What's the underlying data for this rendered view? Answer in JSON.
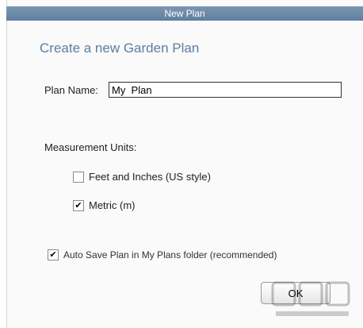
{
  "window": {
    "title": "New Plan"
  },
  "dialog": {
    "heading": "Create a new Garden Plan",
    "plan_name_label": "Plan Name:",
    "plan_name_value": "My  Plan",
    "units_label": "Measurement Units:",
    "units": [
      {
        "label": "Feet and Inches (US style)",
        "checked": false
      },
      {
        "label": "Metric (m)",
        "checked": true
      }
    ],
    "auto_save": {
      "label": "Auto Save Plan in My Plans folder (recommended)",
      "checked": true
    },
    "ok_label": "OK"
  },
  "colors": {
    "titlebar": "#6a89a8",
    "heading": "#5c7e9f"
  }
}
